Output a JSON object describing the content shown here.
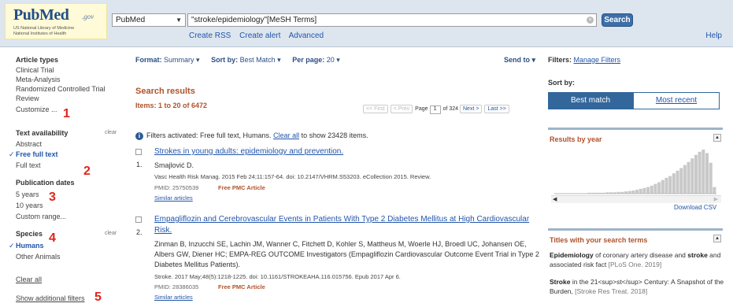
{
  "header": {
    "logo_word": "PubMed",
    "logo_gov": ".gov",
    "logo_line1": "US National Library of Medicine",
    "logo_line2": "National Institutes of Health",
    "database": "PubMed",
    "query": "\"stroke/epidemiology\"[MeSH Terms]",
    "search_label": "Search",
    "links": [
      "Create RSS",
      "Create alert",
      "Advanced"
    ],
    "help": "Help"
  },
  "sidebar": {
    "article_types_label": "Article types",
    "article_types": [
      "Clinical Trial",
      "Meta-Analysis",
      "Randomized Controlled Trial",
      "Review",
      "Customize ..."
    ],
    "text_availability_label": "Text availability",
    "text_availability": [
      "Abstract",
      "Free full text",
      "Full text"
    ],
    "publication_dates_label": "Publication dates",
    "publication_dates": [
      "5 years",
      "10 years",
      "Custom range..."
    ],
    "species_label": "Species",
    "species": [
      "Humans",
      "Other Animals"
    ],
    "clear": "clear",
    "clear_all": "Clear all",
    "show_additional": "Show additional filters",
    "markers": [
      "1",
      "2",
      "3",
      "4",
      "5"
    ]
  },
  "toolbar": {
    "format_label": "Format:",
    "format_value": "Summary",
    "sort_label": "Sort by:",
    "sort_value": "Best Match",
    "per_page_label": "Per page:",
    "per_page_value": "20",
    "send_to": "Send to"
  },
  "results": {
    "title": "Search results",
    "count": "Items: 1 to 20 of 6472",
    "pager": {
      "first": "<< First",
      "prev": "< Prev",
      "page_label": "Page",
      "page": "1",
      "of": "of 324",
      "next": "Next >",
      "last": "Last >>"
    },
    "filter_note_prefix": "Filters activated: Free full text, Humans.",
    "filter_note_link": "Clear all",
    "filter_note_suffix": "to show 23428 items.",
    "items": [
      {
        "num": "1.",
        "title": "Strokes in young adults: epidemiology and prevention.",
        "authors": "Smajlović D.",
        "citation": "Vasc Health Risk Manag. 2015 Feb 24;11:157-64. doi: 10.2147/VHRM.S53203. eCollection 2015. Review.",
        "pmid": "PMID: 25750539",
        "pmc": "Free PMC Article",
        "similar": "Similar articles"
      },
      {
        "num": "2.",
        "title": "Empagliflozin and Cerebrovascular Events in Patients With Type 2 Diabetes Mellitus at High Cardiovascular Risk.",
        "authors": "Zinman B, Inzucchi SE, Lachin JM, Wanner C, Fitchett D, Kohler S, Mattheus M, Woerle HJ, Broedl UC, Johansen OE, Albers GW, Diener HC; EMPA-REG OUTCOME Investigators (Empagliflozin Cardiovascular Outcome Event Trial in Type 2 Diabetes Mellitus Patients).",
        "citation": "Stroke. 2017 May;48(5):1218-1225. doi: 10.1161/STROKEAHA.116.015756. Epub 2017 Apr 6.",
        "pmid": "PMID: 28386035",
        "pmc": "Free PMC Article",
        "similar": "Similar articles"
      }
    ]
  },
  "right": {
    "filters_label": "Filters:",
    "manage_filters": "Manage Filters",
    "sort_by_label": "Sort by:",
    "best_match": "Best match",
    "most_recent": "Most recent",
    "results_by_year": "Results by year",
    "download_csv": "Download CSV",
    "titles_label": "Titles with your search terms",
    "titles": [
      {
        "bold": "Epidemiology",
        "mid": " of coronary artery disease and ",
        "bold2": "stroke",
        "rest": " and associated risk fact",
        "src": " [PLoS One. 2019]"
      },
      {
        "bold": "Stroke",
        "mid": " in the 21<sup>st</sup> Century: A Snapshot of the Burden,",
        "bold2": "",
        "rest": "",
        "src": " [Stroke Res Treat. 2018]"
      }
    ]
  },
  "chart_data": {
    "type": "bar",
    "title": "Results by year",
    "values": [
      1,
      1,
      1,
      1,
      1,
      1,
      1,
      1,
      1,
      2,
      2,
      2,
      2,
      2,
      3,
      3,
      3,
      4,
      4,
      5,
      6,
      7,
      9,
      11,
      13,
      15,
      18,
      22,
      26,
      31,
      36,
      40,
      46,
      52,
      58,
      65,
      72,
      80,
      88,
      95,
      100,
      92,
      70,
      15
    ]
  }
}
